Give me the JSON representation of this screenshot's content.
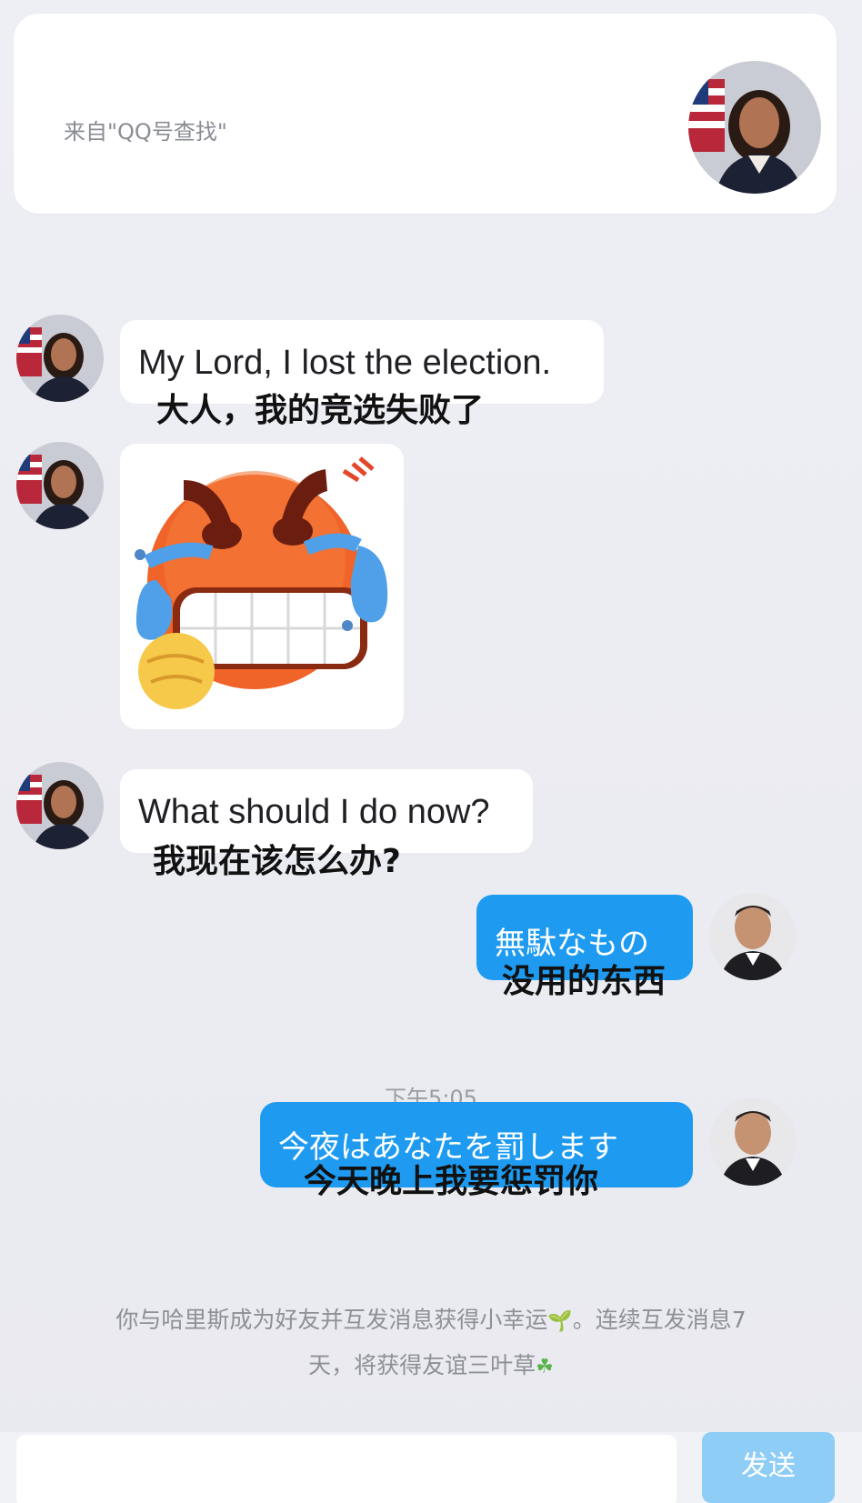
{
  "source_card": {
    "label": "来自\"QQ号查找\""
  },
  "messages": [
    {
      "en": "My Lord, I lost the election.",
      "cn": "大人，我的竞选失败了"
    },
    {
      "sticker": "angry-crying-emoji-sticker"
    },
    {
      "en": "What should I do now?",
      "cn": "我现在该怎么办?"
    },
    {
      "jp": "無駄なもの",
      "cn": "没用的东西"
    },
    {
      "jp": "今夜はあなたを罰します",
      "cn": "今天晚上我要惩罚你"
    }
  ],
  "time_label": "下午5:05",
  "notice": {
    "line1": "你与哈里斯成为好友并互发消息获得小幸运",
    "line1_end": "。连续互发消息7",
    "line2": "天，将获得友谊三叶草"
  },
  "composer": {
    "send_label": "发送"
  },
  "colors": {
    "background": "#ecedf3",
    "sent_bubble": "#1e9bf0",
    "send_button": "#8ecdf5"
  },
  "icons": [
    "avatar",
    "sprout-icon",
    "clover-icon"
  ]
}
